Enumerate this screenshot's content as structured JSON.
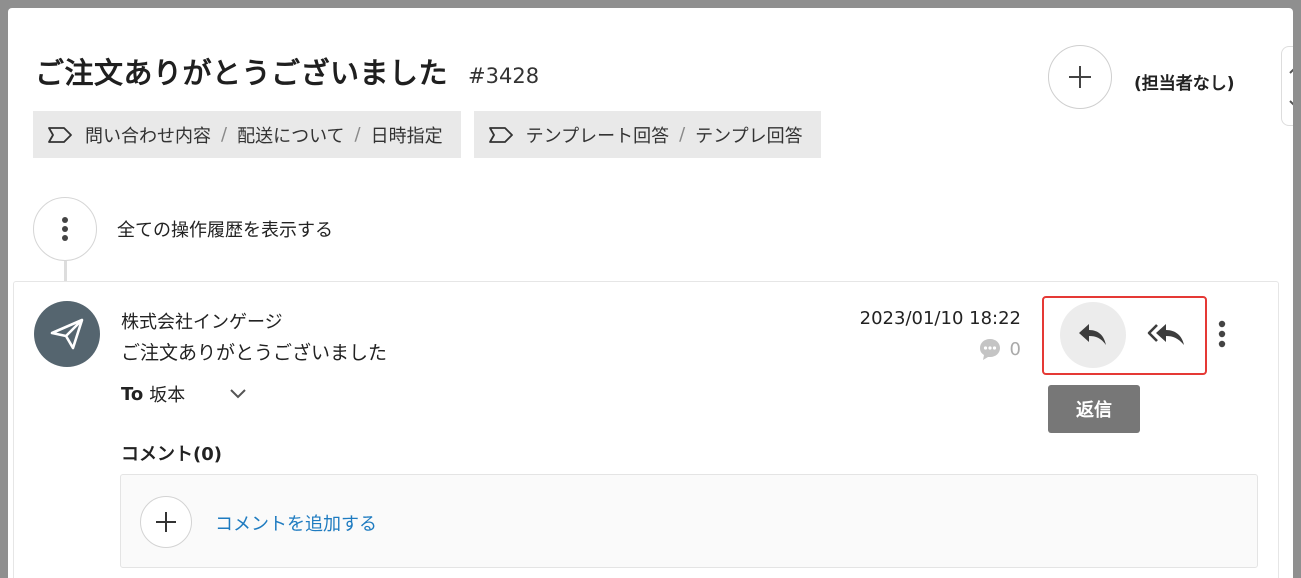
{
  "header": {
    "title": "ご注文ありがとうございました",
    "ticket_id": "#3428",
    "assignee_label": "(担当者なし)"
  },
  "tags": [
    {
      "icon": "tag-icon",
      "parts": [
        "問い合わせ内容",
        "配送について",
        "日時指定"
      ]
    },
    {
      "icon": "tag-icon",
      "parts": [
        "テンプレート回答",
        "テンプレ回答"
      ]
    }
  ],
  "history": {
    "label": "全ての操作履歴を表示する"
  },
  "message": {
    "sender": "株式会社インゲージ",
    "subject": "ご注文ありがとうございました",
    "to_prefix": "To",
    "to_name": "坂本",
    "datetime": "2023/01/10 18:22",
    "comment_count": "0",
    "reply_tooltip": "返信"
  },
  "comments": {
    "title": "コメント(0)",
    "add_label": "コメントを追加する"
  },
  "colors": {
    "highlight": "#e53935",
    "link": "#1e7bc0",
    "avatar": "#55656f"
  }
}
